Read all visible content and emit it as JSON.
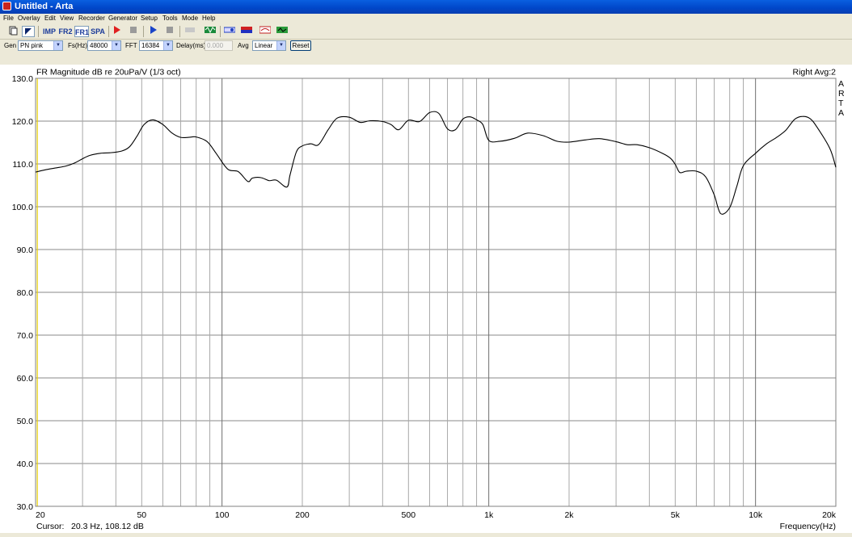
{
  "window": {
    "title": "Untitled - Arta"
  },
  "menu": [
    "File",
    "Overlay",
    "Edit",
    "View",
    "Recorder",
    "Generator",
    "Setup",
    "Tools",
    "Mode",
    "Help"
  ],
  "toolbar": {
    "imp": "IMP",
    "fr2": "FR2",
    "fr1": "FR1",
    "spa": "SPA"
  },
  "controls": {
    "gen_label": "Gen",
    "gen_value": "PN pink",
    "fs_label": "Fs(Hz)",
    "fs_value": "48000",
    "fft_label": "FFT",
    "fft_value": "16384",
    "delay_label": "Delay(ms)",
    "delay_value": "0.000",
    "avg_label": "Avg",
    "avg_value": "Linear",
    "reset_label": "Reset"
  },
  "graph": {
    "title": "FR Magnitude dB re 20uPa/V (1/3 oct)",
    "channel": "Right  Avg:2",
    "side_label": "ARTA",
    "cursor_label": "Cursor:",
    "cursor_value": "20.3 Hz, 108.12 dB",
    "xaxis_label": "Frequency(Hz)"
  },
  "chart_data": {
    "type": "line",
    "xscale": "log",
    "xlim": [
      20,
      20000
    ],
    "ylim": [
      30,
      130
    ],
    "grid": true,
    "xticks": [
      20,
      50,
      100,
      200,
      500,
      1000,
      2000,
      5000,
      10000,
      20000
    ],
    "xtick_labels": [
      "20",
      "50",
      "100",
      "200",
      "500",
      "1k",
      "2k",
      "5k",
      "10k",
      "20k"
    ],
    "yticks": [
      30,
      40,
      50,
      60,
      70,
      80,
      90,
      100,
      110,
      120,
      130
    ],
    "ytick_labels": [
      "30.0",
      "40.0",
      "50.0",
      "60.0",
      "70.0",
      "80.0",
      "90.0",
      "100.0",
      "110.0",
      "120.0",
      "130.0"
    ],
    "cursor_x": 20.3,
    "series": [
      {
        "color": "#000000",
        "x": [
          20,
          22,
          24,
          26,
          28,
          30,
          32,
          35,
          38,
          42,
          45,
          48,
          51,
          55,
          60,
          65,
          70,
          75,
          80,
          88,
          95,
          105,
          115,
          125,
          130,
          140,
          150,
          160,
          175,
          180,
          190,
          200,
          215,
          230,
          250,
          270,
          300,
          330,
          360,
          400,
          430,
          460,
          500,
          550,
          600,
          650,
          700,
          750,
          800,
          850,
          900,
          950,
          1000,
          1100,
          1250,
          1400,
          1600,
          1800,
          2000,
          2300,
          2600,
          3000,
          3300,
          3600,
          4000,
          4500,
          4800,
          5000,
          5200,
          5500,
          6000,
          6500,
          7000,
          7400,
          8000,
          8500,
          9000,
          10000,
          11000,
          12000,
          13000,
          14000,
          15000,
          16000,
          17000,
          19000,
          20000
        ],
        "y": [
          108.1,
          108.7,
          109.1,
          109.5,
          110.2,
          111.2,
          112.0,
          112.5,
          112.6,
          113.0,
          114.0,
          116.5,
          119.2,
          120.3,
          119.2,
          117.2,
          116.2,
          116.2,
          116.3,
          115.2,
          112.5,
          108.8,
          108.2,
          105.9,
          106.7,
          106.8,
          106.1,
          106.2,
          104.6,
          107.5,
          112.8,
          114.2,
          114.7,
          114.5,
          118.0,
          120.7,
          120.9,
          119.7,
          120.1,
          119.9,
          119.2,
          118.0,
          120.2,
          119.9,
          122.0,
          121.8,
          118.2,
          118.0,
          120.5,
          121.0,
          120.3,
          119.2,
          115.5,
          115.3,
          116.0,
          117.2,
          116.6,
          115.3,
          115.1,
          115.6,
          115.9,
          115.2,
          114.5,
          114.5,
          113.8,
          112.4,
          111.3,
          109.9,
          108.0,
          108.3,
          108.3,
          107.0,
          102.8,
          98.4,
          99.8,
          104.7,
          109.6,
          112.5,
          114.7,
          116.2,
          117.9,
          120.4,
          121.1,
          120.6,
          118.6,
          113.6,
          109.2
        ]
      }
    ]
  }
}
